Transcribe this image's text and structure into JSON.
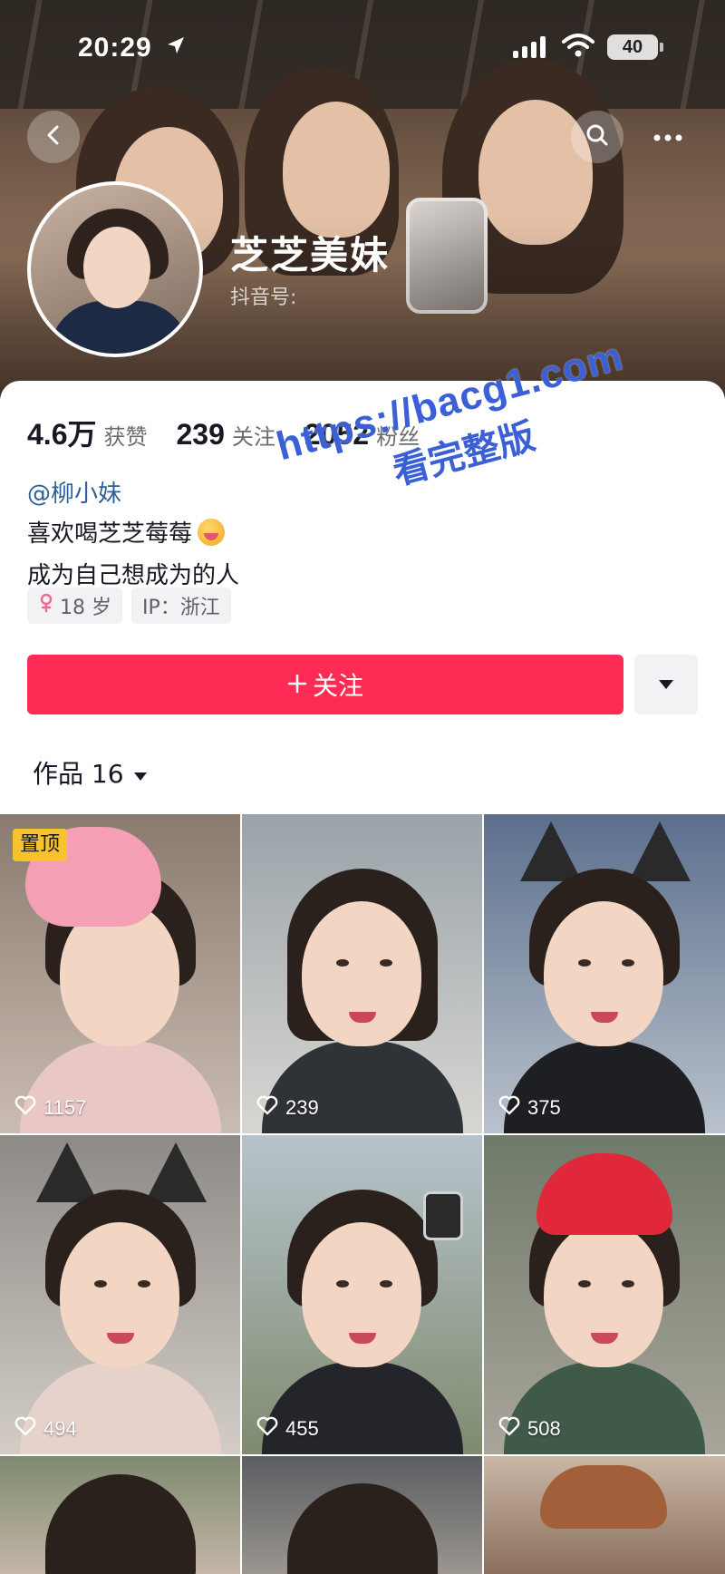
{
  "status_bar": {
    "time": "20:29",
    "battery": "40"
  },
  "profile": {
    "nickname": "芝芝美妹",
    "douyin_id_label": "抖音号:",
    "stats": [
      {
        "value": "4.6万",
        "label": "获赞"
      },
      {
        "value": "239",
        "label": "关注"
      },
      {
        "value": "2052",
        "label": "粉丝"
      }
    ],
    "mention": "@柳小妹",
    "bio_line1": "喜欢喝芝芝莓莓",
    "bio_line2": "成为自己想成为的人",
    "tags": {
      "age": "18 岁",
      "ip": "IP：浙江"
    }
  },
  "actions": {
    "follow_label": "关注"
  },
  "works": {
    "tab_label": "作品 16",
    "pinned_label": "置顶",
    "likes": [
      "1157",
      "239",
      "375",
      "494",
      "455",
      "508"
    ]
  },
  "watermark": {
    "line1": "https://bacg1.com",
    "line2": "看完整版"
  },
  "colors": {
    "accent": "#fe2c55",
    "mention": "#2e5e96",
    "pinned": "#f7c22b",
    "watermark": "#3b5fd6"
  },
  "icons": [
    "location-arrow-icon",
    "signal-icon",
    "wifi-icon",
    "battery-icon",
    "back-icon",
    "search-icon",
    "more-icon",
    "female-icon",
    "plus-icon",
    "caret-down-icon",
    "heart-icon"
  ]
}
